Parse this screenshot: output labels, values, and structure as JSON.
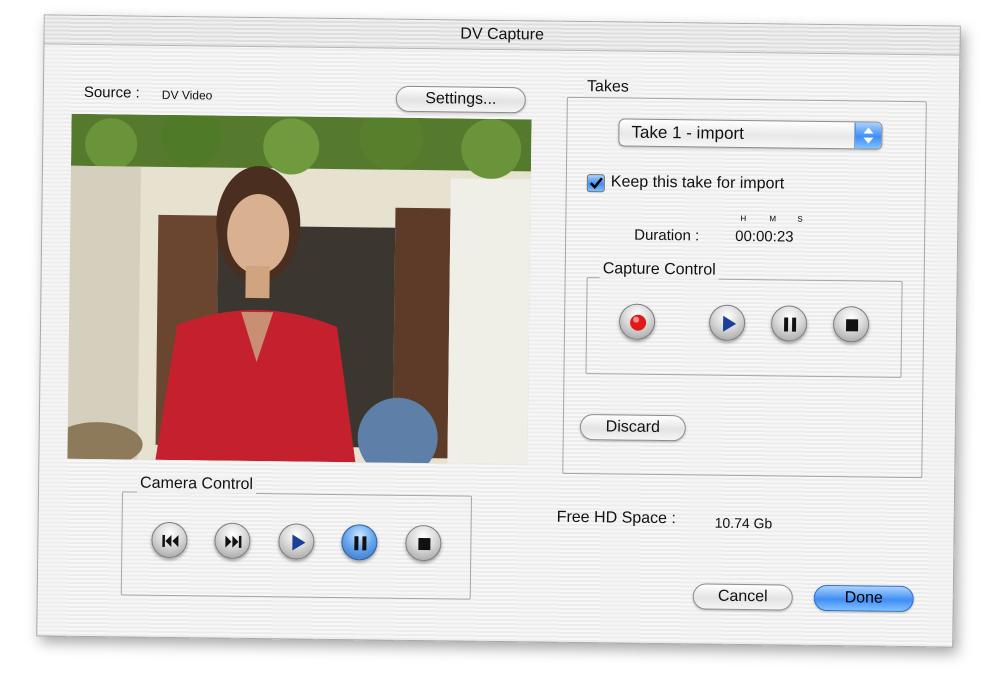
{
  "window": {
    "title": "DV Capture"
  },
  "source": {
    "label": "Source :",
    "value": "DV Video",
    "settings_button": "Settings..."
  },
  "takes": {
    "group_title": "Takes",
    "selected_take": "Take 1 - import",
    "keep_checkbox_label": "Keep this take for import",
    "keep_checked": true,
    "duration_label": "Duration :",
    "duration_value": "00:00:23",
    "duration_units": {
      "h": "H",
      "m": "M",
      "s": "S"
    },
    "discard_button": "Discard"
  },
  "capture_control": {
    "group_title": "Capture Control",
    "buttons": [
      "record-icon",
      "play-icon",
      "pause-icon",
      "stop-icon"
    ]
  },
  "camera_control": {
    "group_title": "Camera Control",
    "buttons": [
      "rewind-icon",
      "fast-forward-icon",
      "play-icon",
      "pause-icon",
      "stop-icon"
    ]
  },
  "disk": {
    "label": "Free HD Space :",
    "value": "10.74 Gb"
  },
  "footer": {
    "cancel_button": "Cancel",
    "done_button": "Done"
  },
  "colors": {
    "accent": "#3f8ef3",
    "record": "#e01a1a",
    "play": "#1c3f9a"
  }
}
